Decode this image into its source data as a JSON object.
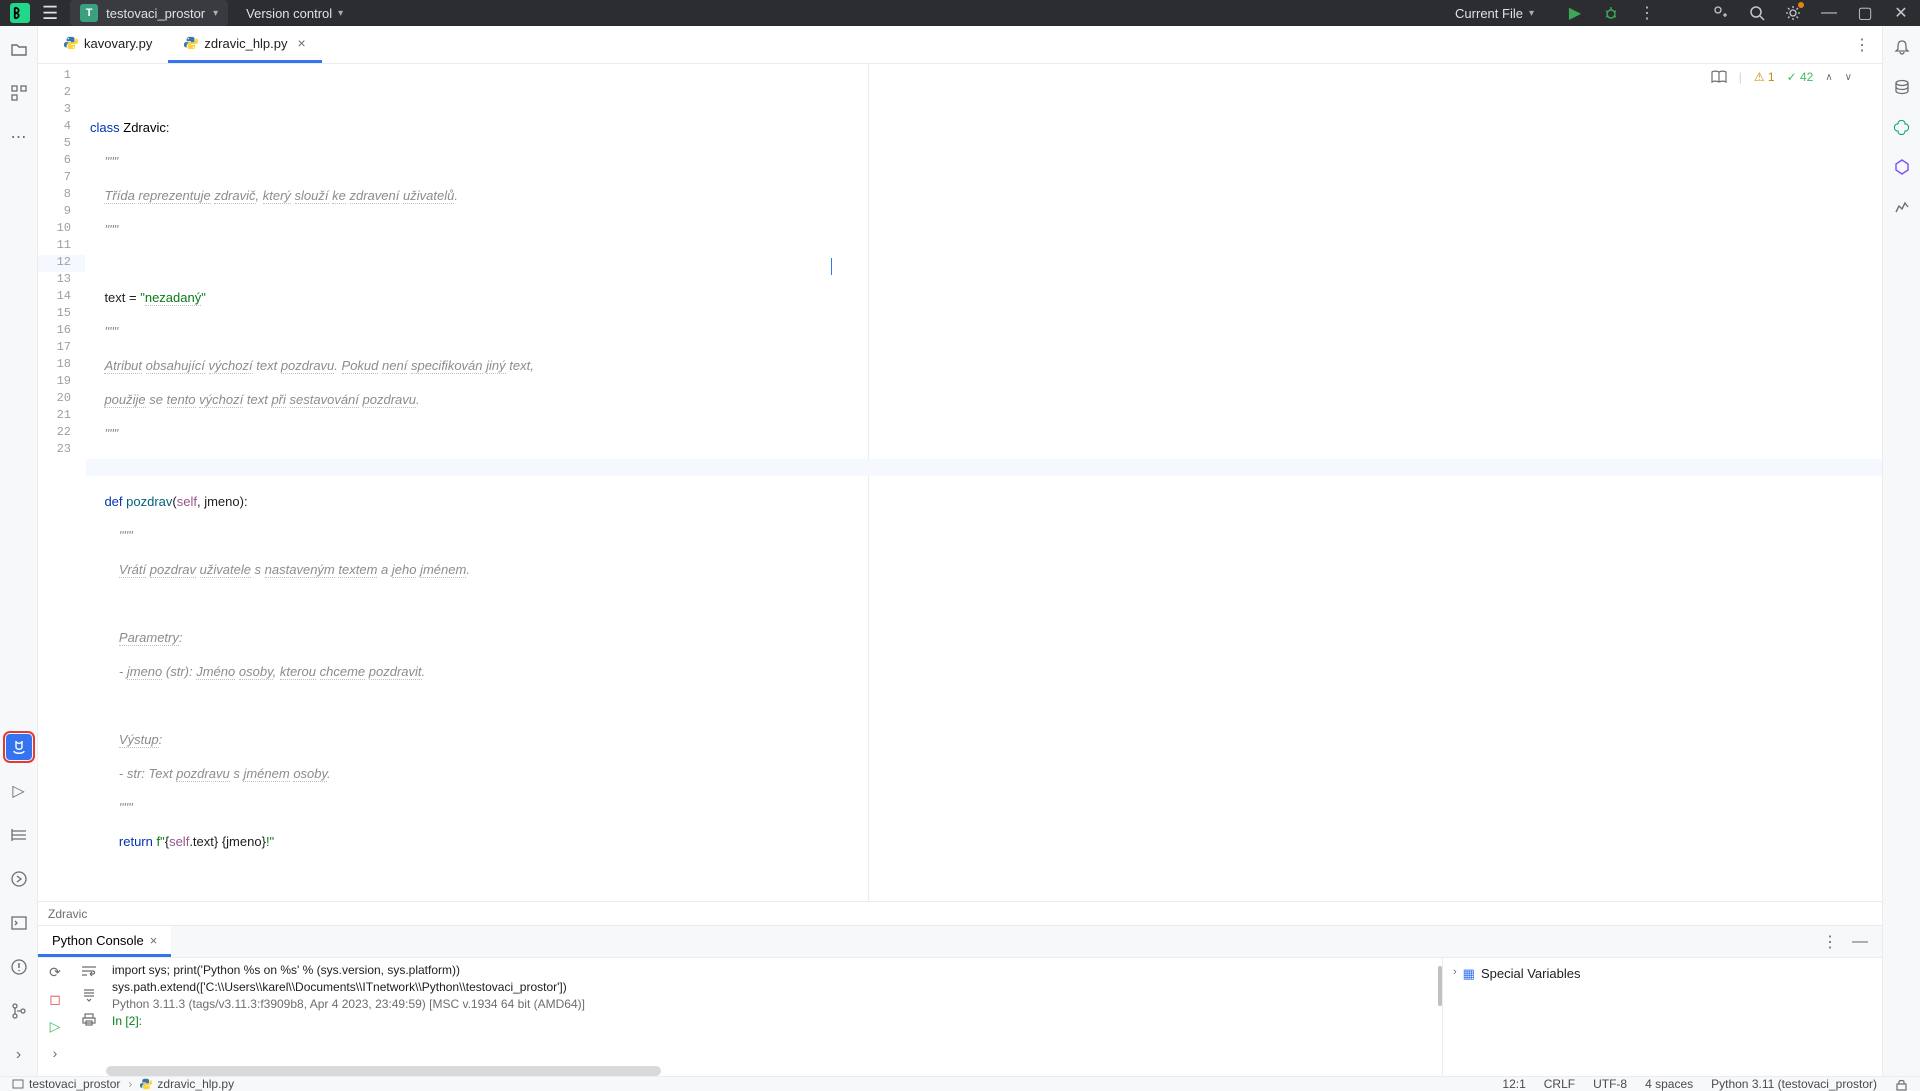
{
  "titlebar": {
    "project_letter": "T",
    "project_name": "testovaci_prostor",
    "vc_label": "Version control",
    "run_config": "Current File"
  },
  "tabs": [
    {
      "label": "kavovary.py",
      "active": false
    },
    {
      "label": "zdravic_hlp.py",
      "active": true,
      "closable": true
    }
  ],
  "inspections": {
    "warnings": "1",
    "weak_warnings": "42"
  },
  "code": {
    "lines": [
      "",
      "class Zdravic:",
      "    \"\"\"",
      "    Třída reprezentuje zdravič, který slouží ke zdravení uživatelů.",
      "    \"\"\"",
      "",
      "    text = \"nezadaný\"",
      "    \"\"\"",
      "    Atribut obsahující výchozí text pozdravu. Pokud není specifikován jiný text,",
      "    použije se tento výchozí text při sestavování pozdravu.",
      "    \"\"\"",
      "",
      "    def pozdrav(self, jmeno):",
      "        \"\"\"",
      "        Vrátí pozdrav uživatele s nastaveným textem a jeho jménem.",
      "",
      "        Parametry:",
      "        - jmeno (str): Jméno osoby, kterou chceme pozdravit.",
      "",
      "        Výstup:",
      "        - str: Text pozdravu s jménem osoby.",
      "        \"\"\"",
      "        return f\"{self.text} {jmeno}!\""
    ]
  },
  "editor_breadcrumb": "Zdravic",
  "console": {
    "tab_label": "Python Console",
    "output": [
      "import sys; print('Python %s on %s' % (sys.version, sys.platform))",
      "sys.path.extend(['C:\\\\Users\\\\karel\\\\Documents\\\\ITnetwork\\\\Python\\\\testovaci_prostor'])",
      "",
      "Python 3.11.3 (tags/v3.11.3:f3909b8, Apr  4 2023, 23:49:59) [MSC v.1934 64 bit (AMD64)]",
      "In [2]:"
    ],
    "vars_label": "Special Variables"
  },
  "statusbar": {
    "crumb1": "testovaci_prostor",
    "crumb2": "zdravic_hlp.py",
    "caret": "12:1",
    "eol": "CRLF",
    "encoding": "UTF-8",
    "indent": "4 spaces",
    "interpreter": "Python 3.11 (testovaci_prostor)"
  }
}
